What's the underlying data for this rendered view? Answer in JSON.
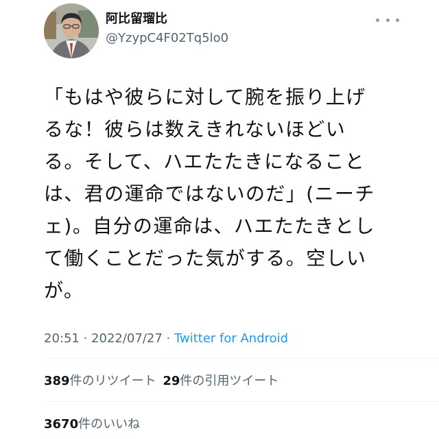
{
  "author": {
    "name": "阿比留瑠比",
    "handle": "@YzypC4F02Tq5lo0"
  },
  "tweet": {
    "lines": [
      "「もはや彼らに対して腕を振り上げ",
      "るな！彼らは数えきれないほどい",
      "る。そして、ハエたたきになること",
      "は、君の運命ではないのだ」(ニーチ",
      "ェ)。自分の運命は、ハエたたきとし",
      "て働くことだった気がする。空しい",
      "が。"
    ],
    "time": "20:51",
    "date": "2022/07/27",
    "source": "Twitter for Android"
  },
  "stats": {
    "retweets": {
      "count": "389",
      "label": "件のリツイート"
    },
    "quotes": {
      "count": "29",
      "label": "件の引用ツイート"
    },
    "likes": {
      "count": "3670",
      "label": "件のいいね"
    }
  },
  "icons": {
    "more": "more-options-icon",
    "avatar": "profile-photo"
  },
  "colors": {
    "text": "#0f1419",
    "secondary": "#536471",
    "link": "#1d9bf0",
    "divider": "#eff3f4"
  }
}
